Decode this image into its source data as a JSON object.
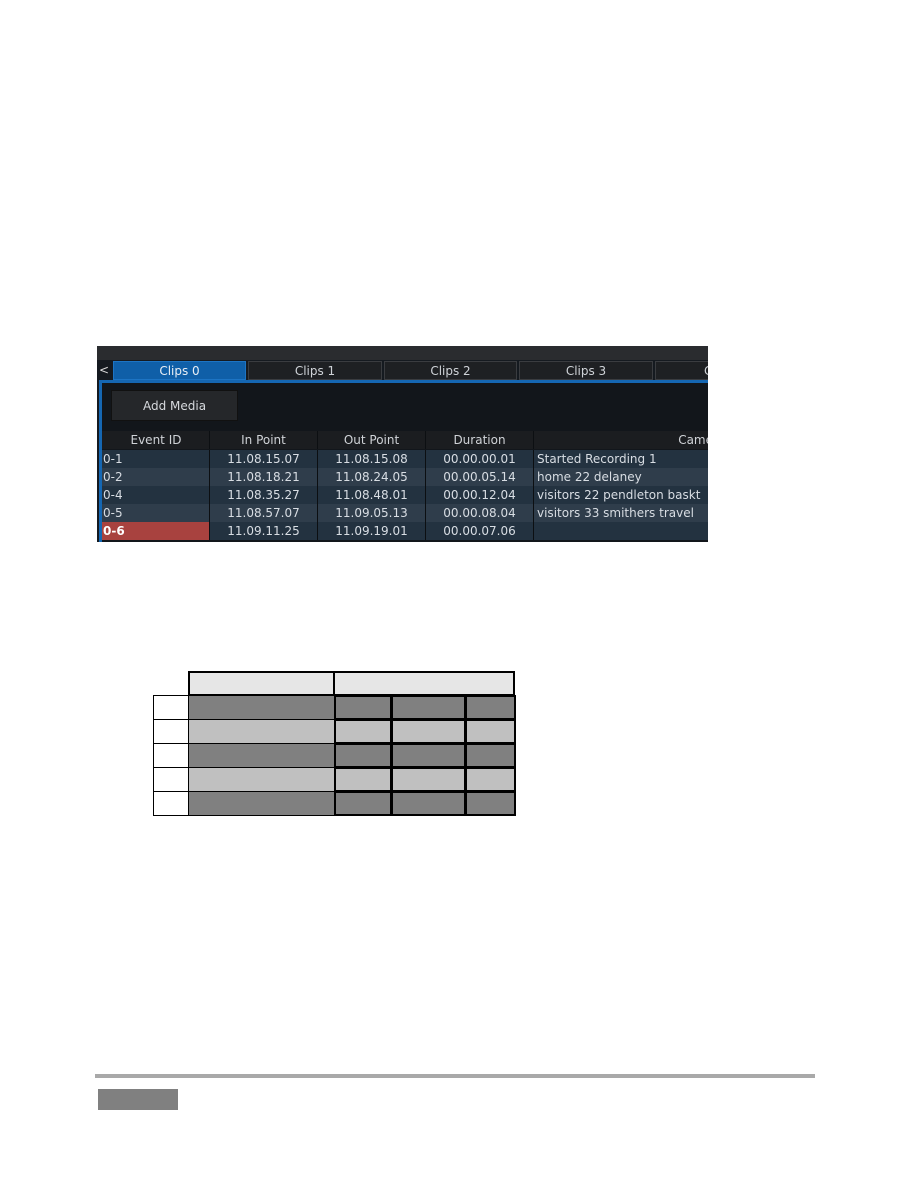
{
  "screenshot": {
    "nav_back": "<",
    "tabs": [
      {
        "label": "Clips 0",
        "active": true
      },
      {
        "label": "Clips 1"
      },
      {
        "label": "Clips 2"
      },
      {
        "label": "Clips 3"
      },
      {
        "label": "C"
      }
    ],
    "add_media": "Add Media",
    "columns": [
      "Event ID",
      "In Point",
      "Out Point",
      "Duration",
      "Came"
    ],
    "rows": [
      [
        "0-1",
        "11.08.15.07",
        "11.08.15.08",
        "00.00.00.01",
        "Started Recording 1"
      ],
      [
        "0-2",
        "11.08.18.21",
        "11.08.24.05",
        "00.00.05.14",
        "home 22 delaney"
      ],
      [
        "0-4",
        "11.08.35.27",
        "11.08.48.01",
        "00.00.12.04",
        "visitors 22 pendleton baskt"
      ],
      [
        "0-5",
        "11.08.57.07",
        "11.09.05.13",
        "00.00.08.04",
        "visitors 33 smithers travel"
      ],
      [
        "0-6",
        "11.09.11.25",
        "11.09.19.01",
        "00.00.07.06",
        ""
      ]
    ],
    "selected_row": 4,
    "colors": {
      "active_tab": "#0f5fa8",
      "selected_id": "#a8423f",
      "row_dark": "#233240",
      "row_light": "#2f3d4b"
    }
  },
  "figure_table": {
    "colors": {
      "header": "#e6e6e6",
      "dark": "#808080",
      "light": "#c0c0c0"
    }
  }
}
